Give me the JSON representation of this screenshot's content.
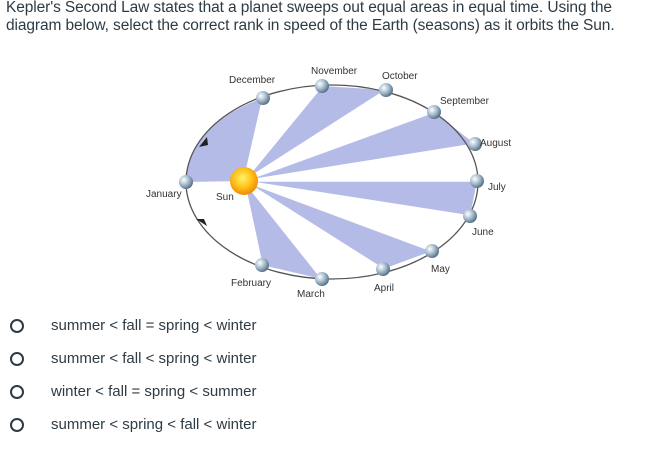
{
  "question": "Kepler's Second Law states that a planet sweeps out equal areas in equal time. Using the diagram below, select the correct rank in speed of the Earth (seasons) as it orbits the Sun.",
  "diagram": {
    "sun_label": "Sun",
    "months": {
      "january": "January",
      "february": "February",
      "march": "March",
      "april": "April",
      "may": "May",
      "june": "June",
      "july": "July",
      "august": "August",
      "september": "September",
      "october": "October",
      "november": "November",
      "december": "December"
    },
    "colors": {
      "wedge": "#b4bbe6",
      "orbit": "#555555",
      "sun": "#f4a300"
    }
  },
  "options": [
    "summer < fall = spring < winter",
    "summer < fall < spring < winter",
    "winter < fall = spring < summer",
    "summer < spring < fall < winter"
  ]
}
